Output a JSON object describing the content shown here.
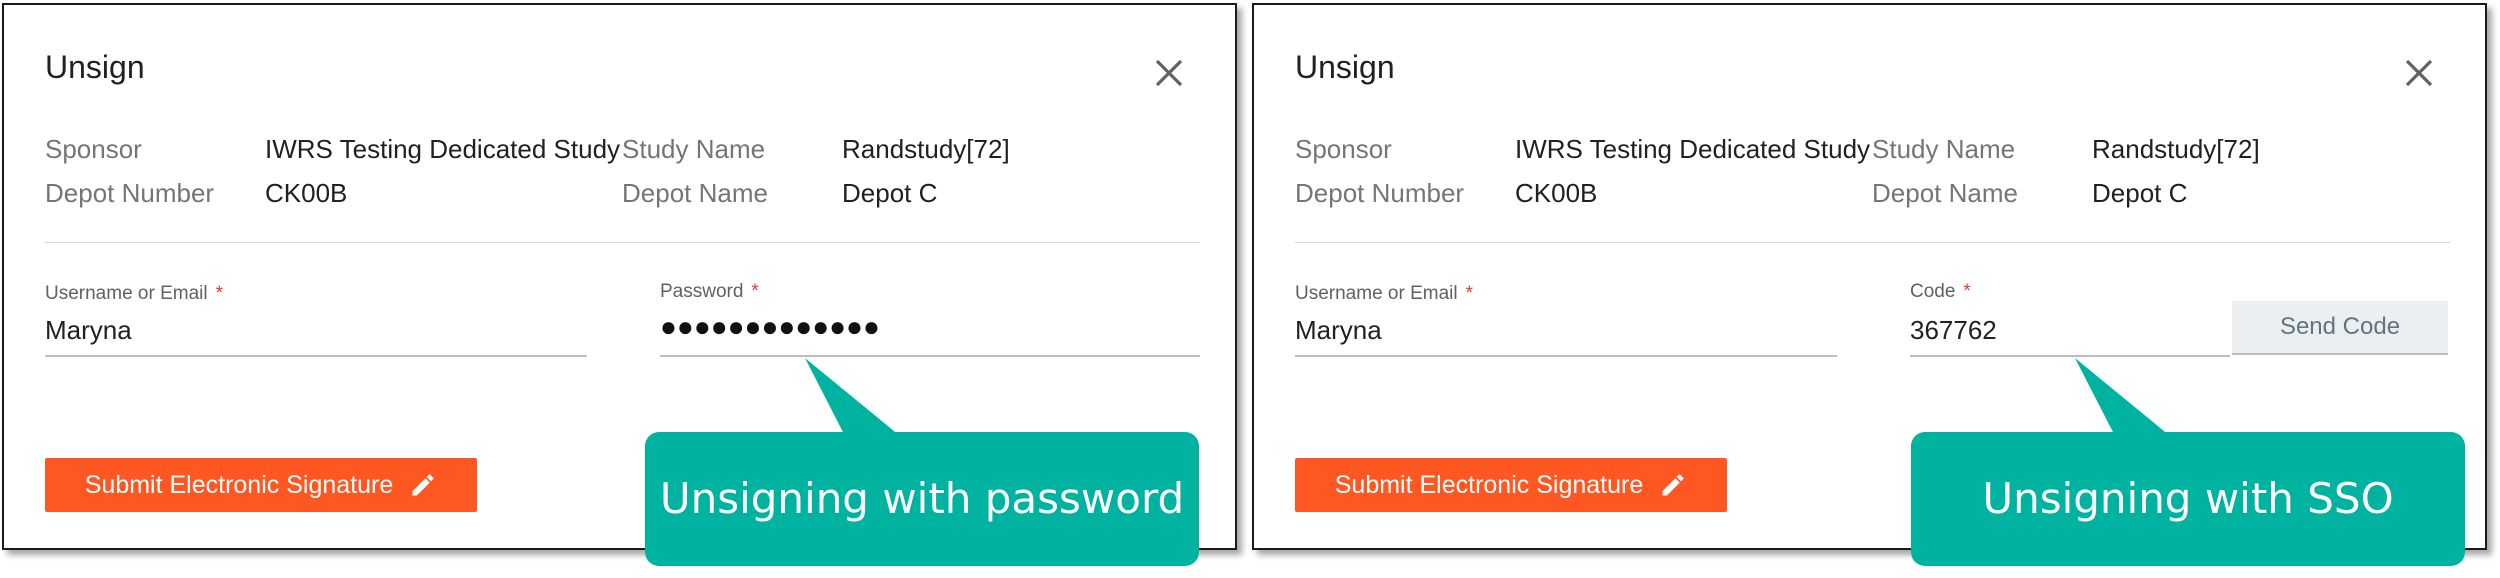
{
  "colors": {
    "accent_button": "#ff5722",
    "callout": "#00b3a0",
    "required_star": "#e53935",
    "send_code_bg": "#eceff1"
  },
  "dialogs": [
    {
      "title": "Unsign",
      "info": {
        "sponsor_label": "Sponsor",
        "sponsor_value": "IWRS Testing Dedicated Study",
        "study_name_label": "Study Name",
        "study_name_value": "Randstudy[72]",
        "depot_number_label": "Depot Number",
        "depot_number_value": "CK00B",
        "depot_name_label": "Depot Name",
        "depot_name_value": "Depot C"
      },
      "username": {
        "label": "Username or Email",
        "required": "*",
        "value": "Maryna"
      },
      "password": {
        "label": "Password",
        "required": "*",
        "value": "●●●●●●●●●●●●●"
      },
      "submit_label": "Submit Electronic Signature",
      "callout": "Unsigning with password"
    },
    {
      "title": "Unsign",
      "info": {
        "sponsor_label": "Sponsor",
        "sponsor_value": "IWRS Testing Dedicated Study",
        "study_name_label": "Study Name",
        "study_name_value": "Randstudy[72]",
        "depot_number_label": "Depot Number",
        "depot_number_value": "CK00B",
        "depot_name_label": "Depot Name",
        "depot_name_value": "Depot C"
      },
      "username": {
        "label": "Username or Email",
        "required": "*",
        "value": "Maryna"
      },
      "code": {
        "label": "Code",
        "required": "*",
        "value": "367762"
      },
      "send_code_label": "Send Code",
      "submit_label": "Submit Electronic Signature",
      "callout": "Unsigning with SSO"
    }
  ],
  "icons": {
    "close": "close-icon",
    "pencil": "pencil-icon"
  }
}
